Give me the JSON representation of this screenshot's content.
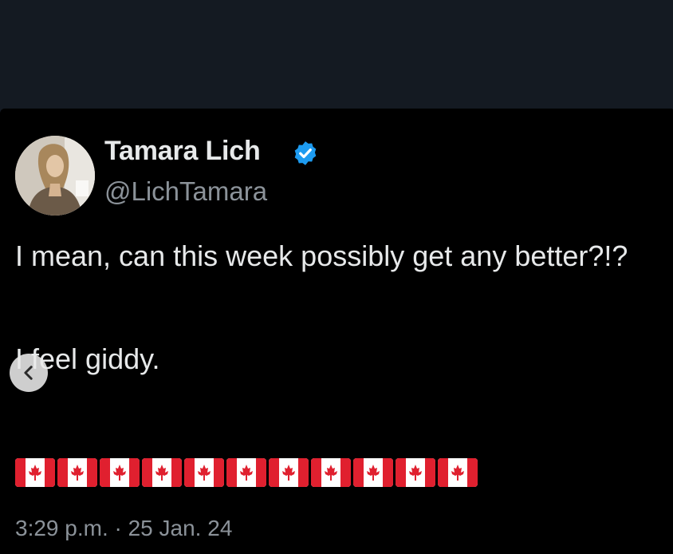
{
  "author": {
    "display_name": "Tamara Lich",
    "handle": "@LichTamara",
    "verified_icon": "verified-badge-icon",
    "avatar_icon": "profile-photo"
  },
  "tweet": {
    "line1": "I mean, can this week possibly get any better?!?",
    "line2": "I feel giddy.",
    "emoji_row": "🇨🇦🇨🇦🇨🇦🇨🇦🇨🇦🇨🇦🇨🇦🇨🇦🇨🇦🇨🇦🇨🇦",
    "flag_count": 11,
    "timestamp": "3:29 p.m. · 25 Jan. 24"
  },
  "overlay": {
    "back_icon": "chevron-left-icon"
  },
  "colors": {
    "background": "#000000",
    "text_primary": "#e7e9ea",
    "text_secondary": "#8b9299",
    "verified_blue": "#1d9bf0",
    "flag_red": "#e0202f"
  }
}
